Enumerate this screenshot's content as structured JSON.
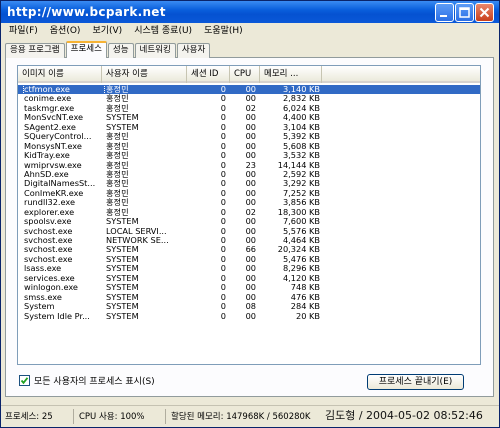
{
  "window": {
    "title": "http://www.bcpark.net"
  },
  "menu": [
    {
      "label": "파일(F)"
    },
    {
      "label": "옵션(O)"
    },
    {
      "label": "보기(V)"
    },
    {
      "label": "시스템 종료(U)"
    },
    {
      "label": "도움말(H)"
    }
  ],
  "tabs": [
    {
      "label": "응용 프로그램",
      "active": false
    },
    {
      "label": "프로세스",
      "active": true
    },
    {
      "label": "성능",
      "active": false
    },
    {
      "label": "네트워킹",
      "active": false
    },
    {
      "label": "사용자",
      "active": false
    }
  ],
  "table": {
    "columns": [
      "이미지 이름",
      "사용자 이름",
      "세션 ID",
      "CPU",
      "메모리 ..."
    ],
    "selected_index": 0,
    "rows": [
      {
        "name": "ctfmon.exe",
        "user": "홍정민",
        "session": "0",
        "cpu": "00",
        "mem": "3,140 KB"
      },
      {
        "name": "conime.exe",
        "user": "홍정민",
        "session": "0",
        "cpu": "00",
        "mem": "2,832 KB"
      },
      {
        "name": "taskmgr.exe",
        "user": "홍정민",
        "session": "0",
        "cpu": "02",
        "mem": "6,024 KB"
      },
      {
        "name": "MonSvcNT.exe",
        "user": "SYSTEM",
        "session": "0",
        "cpu": "00",
        "mem": "4,400 KB"
      },
      {
        "name": "SAgent2.exe",
        "user": "SYSTEM",
        "session": "0",
        "cpu": "00",
        "mem": "3,104 KB"
      },
      {
        "name": "SQueryControl...",
        "user": "홍정민",
        "session": "0",
        "cpu": "00",
        "mem": "5,392 KB"
      },
      {
        "name": "MonsysNT.exe",
        "user": "홍정민",
        "session": "0",
        "cpu": "00",
        "mem": "5,608 KB"
      },
      {
        "name": "KidTray.exe",
        "user": "홍정민",
        "session": "0",
        "cpu": "00",
        "mem": "3,532 KB"
      },
      {
        "name": "wmiprvsw.exe",
        "user": "홍정민",
        "session": "0",
        "cpu": "23",
        "mem": "14,144 KB"
      },
      {
        "name": "AhnSD.exe",
        "user": "홍정민",
        "session": "0",
        "cpu": "00",
        "mem": "2,592 KB"
      },
      {
        "name": "DigitalNamesSt...",
        "user": "홍정민",
        "session": "0",
        "cpu": "00",
        "mem": "3,292 KB"
      },
      {
        "name": "ConImeKR.exe",
        "user": "홍정민",
        "session": "0",
        "cpu": "00",
        "mem": "7,252 KB"
      },
      {
        "name": "rundll32.exe",
        "user": "홍정민",
        "session": "0",
        "cpu": "00",
        "mem": "3,856 KB"
      },
      {
        "name": "explorer.exe",
        "user": "홍정민",
        "session": "0",
        "cpu": "02",
        "mem": "18,300 KB"
      },
      {
        "name": "spoolsv.exe",
        "user": "SYSTEM",
        "session": "0",
        "cpu": "00",
        "mem": "7,600 KB"
      },
      {
        "name": "svchost.exe",
        "user": "LOCAL SERVI...",
        "session": "0",
        "cpu": "00",
        "mem": "5,576 KB"
      },
      {
        "name": "svchost.exe",
        "user": "NETWORK SE...",
        "session": "0",
        "cpu": "00",
        "mem": "4,464 KB"
      },
      {
        "name": "svchost.exe",
        "user": "SYSTEM",
        "session": "0",
        "cpu": "66",
        "mem": "20,324 KB"
      },
      {
        "name": "svchost.exe",
        "user": "SYSTEM",
        "session": "0",
        "cpu": "00",
        "mem": "5,476 KB"
      },
      {
        "name": "lsass.exe",
        "user": "SYSTEM",
        "session": "0",
        "cpu": "00",
        "mem": "8,296 KB"
      },
      {
        "name": "services.exe",
        "user": "SYSTEM",
        "session": "0",
        "cpu": "00",
        "mem": "4,120 KB"
      },
      {
        "name": "winlogon.exe",
        "user": "SYSTEM",
        "session": "0",
        "cpu": "00",
        "mem": "748 KB"
      },
      {
        "name": "smss.exe",
        "user": "SYSTEM",
        "session": "0",
        "cpu": "00",
        "mem": "476 KB"
      },
      {
        "name": "System",
        "user": "SYSTEM",
        "session": "0",
        "cpu": "08",
        "mem": "284 KB"
      },
      {
        "name": "System Idle Pr...",
        "user": "SYSTEM",
        "session": "0",
        "cpu": "00",
        "mem": "20 KB"
      }
    ]
  },
  "show_all_users": {
    "label": "모든 사용자의 프로세스 표시(S)",
    "checked": true
  },
  "end_process_label": "프로세스 끝내기(E)",
  "status": {
    "processes": "프로세스: 25",
    "cpu": "CPU 사용: 100%",
    "memory": "할당된 메모리: 147968K / 560280K"
  },
  "watermark": "김도형 / 2004-05-02 08:52:46",
  "colors": {
    "title_bar": "#0a5fdc",
    "selection": "#316ac5",
    "window_bg": "#ece9d8"
  }
}
